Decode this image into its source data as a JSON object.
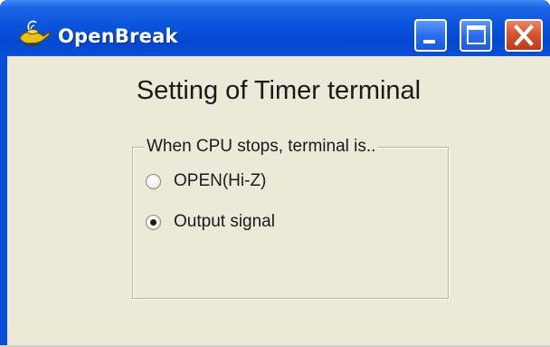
{
  "window": {
    "title": "OpenBreak",
    "icon": "genie-lamp-icon",
    "buttons": {
      "minimize": "minimize-icon",
      "maximize": "maximize-icon",
      "close": "close-icon"
    },
    "colors": {
      "titlebar": "#0a54dc",
      "close_button": "#d4502b",
      "client_bg": "#ece9d8"
    }
  },
  "main": {
    "heading": "Setting of Timer terminal",
    "group": {
      "caption": "When CPU stops, terminal is..",
      "options": [
        {
          "label": "OPEN(Hi-Z)",
          "selected": false
        },
        {
          "label": "Output signal",
          "selected": true
        }
      ]
    }
  }
}
